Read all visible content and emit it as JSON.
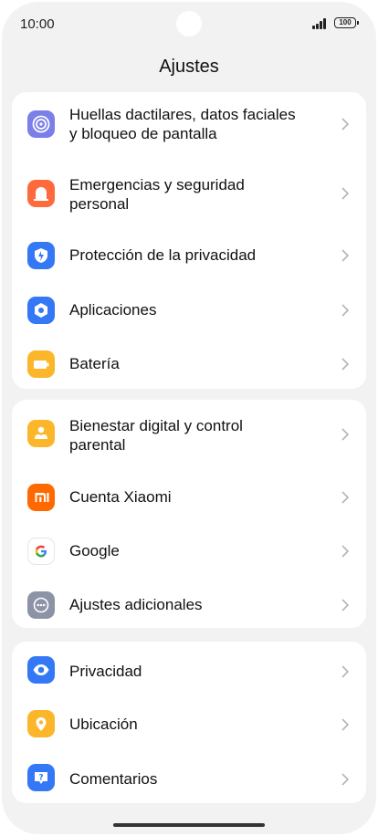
{
  "status_bar": {
    "time": "10:00",
    "battery_level": "100"
  },
  "page_title": "Ajustes",
  "groups": [
    {
      "items": [
        {
          "label": "Huellas dactilares, datos faciales\ny bloqueo de pantalla",
          "icon": "fingerprint-icon",
          "color": "#7b7fe8"
        },
        {
          "label": "Emergencias y seguridad\npersonal",
          "icon": "emergency-icon",
          "color": "#ff6a3d"
        },
        {
          "label": "Protección de la privacidad",
          "icon": "privacy-protection-icon",
          "color": "#3478f6"
        },
        {
          "label": "Aplicaciones",
          "icon": "apps-icon",
          "color": "#3478f6"
        },
        {
          "label": "Batería",
          "icon": "battery-icon",
          "color": "#fbb62a"
        }
      ]
    },
    {
      "items": [
        {
          "label": "Bienestar digital y control\nparental",
          "icon": "digital-wellbeing-icon",
          "color": "#fbb62a"
        },
        {
          "label": "Cuenta Xiaomi",
          "icon": "xiaomi-icon",
          "color": "#ff6900"
        },
        {
          "label": "Google",
          "icon": "google-icon",
          "color": "#ffffff"
        },
        {
          "label": "Ajustes adicionales",
          "icon": "more-settings-icon",
          "color": "#8d93a6"
        }
      ]
    },
    {
      "items": [
        {
          "label": "Privacidad",
          "icon": "eye-icon",
          "color": "#3478f6"
        },
        {
          "label": "Ubicación",
          "icon": "location-icon",
          "color": "#fbb62a"
        },
        {
          "label": "Comentarios",
          "icon": "feedback-icon",
          "color": "#3478f6"
        }
      ]
    }
  ]
}
